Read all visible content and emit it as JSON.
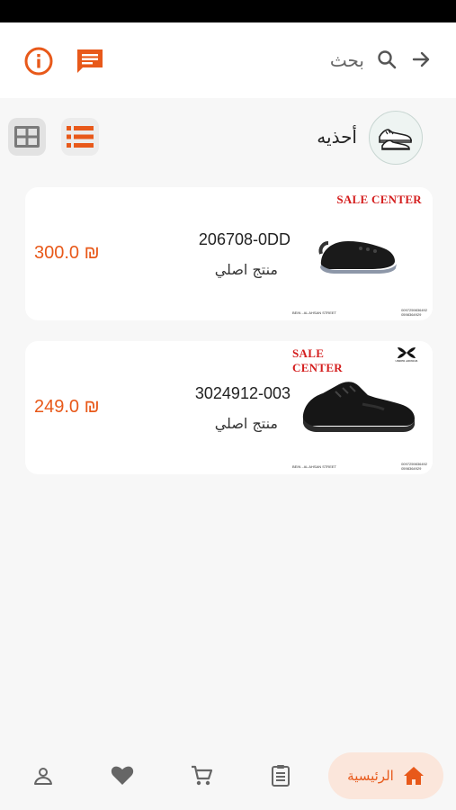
{
  "header": {
    "search_label": "بحث",
    "icons": [
      "arrow-forward-icon",
      "search-icon",
      "chat-icon",
      "info-icon"
    ]
  },
  "category": {
    "title": "أحذيه",
    "icon": "sneakers-icon"
  },
  "products": [
    {
      "code": "206708-0DD",
      "subtitle": "منتج اصلي",
      "price": "300.0",
      "currency": "₪",
      "badge": "SALE CENTER",
      "store_address": "BEIN - AL AHSAN STREET",
      "store_phones": "0097259836492\n0598364929"
    },
    {
      "code": "3024912-003",
      "subtitle": "منتج اصلي",
      "price": "249.0",
      "currency": "₪",
      "badge": "SALE CENTER",
      "store_address": "BEIN - AL AHSAN STREET",
      "store_phones": "0097259836492\n0598364929",
      "brand": "UNDER ARMOUR"
    }
  ],
  "bottom_nav": {
    "home_label": "الرئيسية"
  },
  "colors": {
    "accent": "#e8591a",
    "accent_light": "#fbe6db",
    "sale_red": "#d41e1e"
  }
}
